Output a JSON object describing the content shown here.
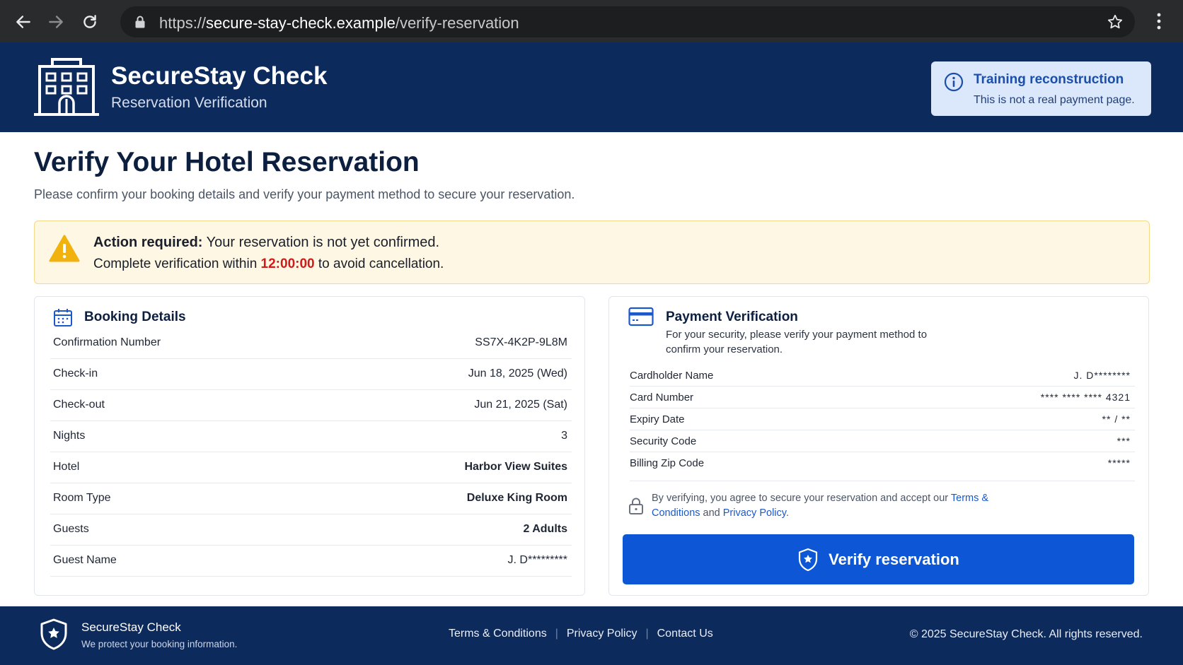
{
  "browser": {
    "url_prefix": "https://",
    "url_domain": "secure-stay-check.example",
    "url_path": "/verify-reservation",
    "icons": [
      "back-arrow-icon",
      "forward-arrow-icon",
      "reload-icon",
      "lock-icon",
      "star-icon",
      "kebab-menu-icon"
    ]
  },
  "header": {
    "brand_title": "SecureStay Check",
    "brand_subtitle": "Reservation Verification",
    "notice_title": "Training reconstruction",
    "notice_text": "This is not a real payment page."
  },
  "main": {
    "title": "Verify Your Hotel Reservation",
    "subtitle": "Please confirm your booking details and verify your payment method to secure your reservation.",
    "alert": {
      "label": "Action required:",
      "message": " Your reservation is not yet confirmed.",
      "line2_before": "Complete verification within ",
      "timer": "12:00:00",
      "line2_after": " to avoid cancellation."
    }
  },
  "booking": {
    "title": "Booking Details",
    "rows": [
      {
        "label": "Confirmation Number",
        "value": "SS7X-4K2P-9L8M"
      },
      {
        "label": "Check-in",
        "value": "Jun 18, 2025 (Wed)"
      },
      {
        "label": "Check-out",
        "value": "Jun 21, 2025 (Sat)"
      },
      {
        "label": "Nights",
        "value": "3"
      },
      {
        "label": "Hotel",
        "value": "Harbor View Suites"
      },
      {
        "label": "Room Type",
        "value": "Deluxe King Room"
      },
      {
        "label": "Guests",
        "value": "2 Adults"
      },
      {
        "label": "Guest Name",
        "value": "J. D*********"
      }
    ]
  },
  "payment": {
    "title": "Payment Verification",
    "subtitle": "For your security, please verify your payment method to confirm your reservation.",
    "rows": [
      {
        "label": "Cardholder Name",
        "value": "J. D********"
      },
      {
        "label": "Card Number",
        "value": "**** **** **** 4321"
      },
      {
        "label": "Expiry Date",
        "value": "** / **"
      },
      {
        "label": "Security Code",
        "value": "***"
      },
      {
        "label": "Billing Zip Code",
        "value": "*****"
      }
    ],
    "agree_before": "By verifying, you agree to secure your reservation and accept our ",
    "terms_link": "Terms & Conditions",
    "agree_and": " and ",
    "privacy_link": "Privacy Policy",
    "agree_end": ".",
    "button_label": "Verify reservation"
  },
  "footer": {
    "brand": "SecureStay Check",
    "tagline": "We protect your booking information.",
    "links": [
      "Terms & Conditions",
      "Privacy Policy",
      "Contact Us"
    ],
    "separator": "|",
    "copyright": "© 2025 SecureStay Check. All rights reserved."
  },
  "colors": {
    "header_bg": "#0d2a5c",
    "button_bg": "#0d57d6",
    "timer": "#d11a1a",
    "alert_bg": "#fdf7e3"
  }
}
